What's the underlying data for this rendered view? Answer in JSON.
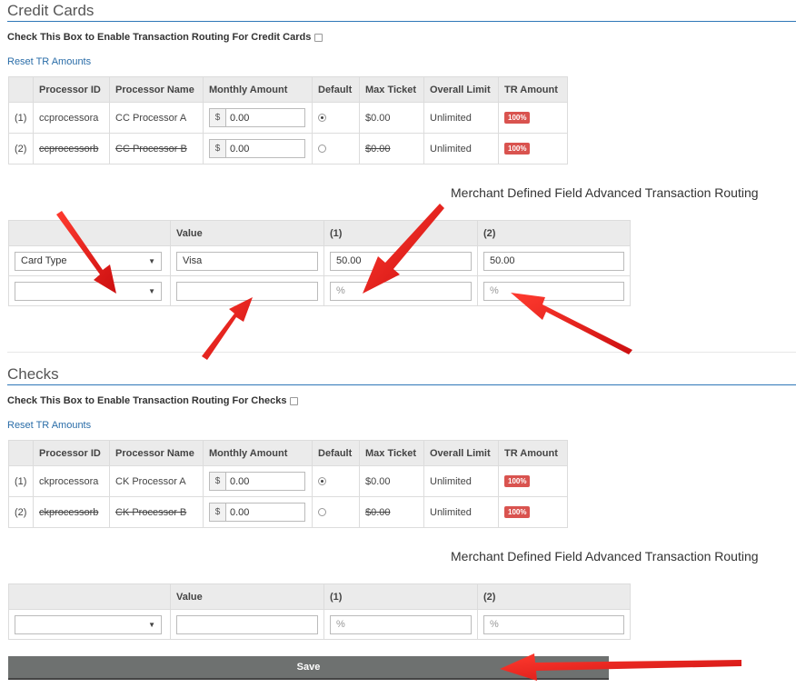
{
  "credit_cards": {
    "title": "Credit Cards",
    "enable_label": "Check This Box to Enable Transaction Routing For Credit Cards",
    "reset_link": "Reset TR Amounts",
    "columns": [
      "",
      "Processor ID",
      "Processor Name",
      "Monthly Amount",
      "Default",
      "Max Ticket",
      "Overall Limit",
      "TR Amount"
    ],
    "rows": [
      {
        "idx": "(1)",
        "processor_id": "ccprocessora",
        "processor_name": "CC Processor A",
        "currency": "$",
        "monthly_amount": "0.00",
        "default_selected": true,
        "max_ticket": "$0.00",
        "overall_limit": "Unlimited",
        "tr_amount": "100%"
      },
      {
        "idx": "(2)",
        "processor_id": "ccprocessorb",
        "processor_name": "CC Processor B",
        "currency": "$",
        "monthly_amount": "0.00",
        "default_selected": false,
        "max_ticket": "$0.00",
        "overall_limit": "Unlimited",
        "tr_amount": "100%"
      }
    ],
    "mdf": {
      "title": "Merchant Defined Field Advanced Transaction Routing",
      "columns": [
        "",
        "Value",
        "(1)",
        "(2)"
      ],
      "rows": [
        {
          "field": "Card Type",
          "value": "Visa",
          "p1": "50.00",
          "p2": "50.00"
        },
        {
          "field": "",
          "value": "",
          "p1_placeholder": "%",
          "p2_placeholder": "%"
        }
      ]
    }
  },
  "checks": {
    "title": "Checks",
    "enable_label": "Check This Box to Enable Transaction Routing For Checks",
    "reset_link": "Reset TR Amounts",
    "columns": [
      "",
      "Processor ID",
      "Processor Name",
      "Monthly Amount",
      "Default",
      "Max Ticket",
      "Overall Limit",
      "TR Amount"
    ],
    "rows": [
      {
        "idx": "(1)",
        "processor_id": "ckprocessora",
        "processor_name": "CK Processor A",
        "currency": "$",
        "monthly_amount": "0.00",
        "default_selected": true,
        "max_ticket": "$0.00",
        "overall_limit": "Unlimited",
        "tr_amount": "100%"
      },
      {
        "idx": "(2)",
        "processor_id": "ckprocessorb",
        "processor_name": "CK Processor B",
        "currency": "$",
        "monthly_amount": "0.00",
        "default_selected": false,
        "max_ticket": "$0.00",
        "overall_limit": "Unlimited",
        "tr_amount": "100%"
      }
    ],
    "mdf": {
      "title": "Merchant Defined Field Advanced Transaction Routing",
      "columns": [
        "",
        "Value",
        "(1)",
        "(2)"
      ],
      "rows": [
        {
          "field": "",
          "value": "",
          "p1_placeholder": "%",
          "p2_placeholder": "%"
        }
      ]
    }
  },
  "save_label": "Save",
  "colors": {
    "accent_rule": "#2e77b8",
    "link": "#2a6da8",
    "badge": "#d9534f",
    "save_button": "#6e7170",
    "annotation_arrow": "#e8191b"
  }
}
